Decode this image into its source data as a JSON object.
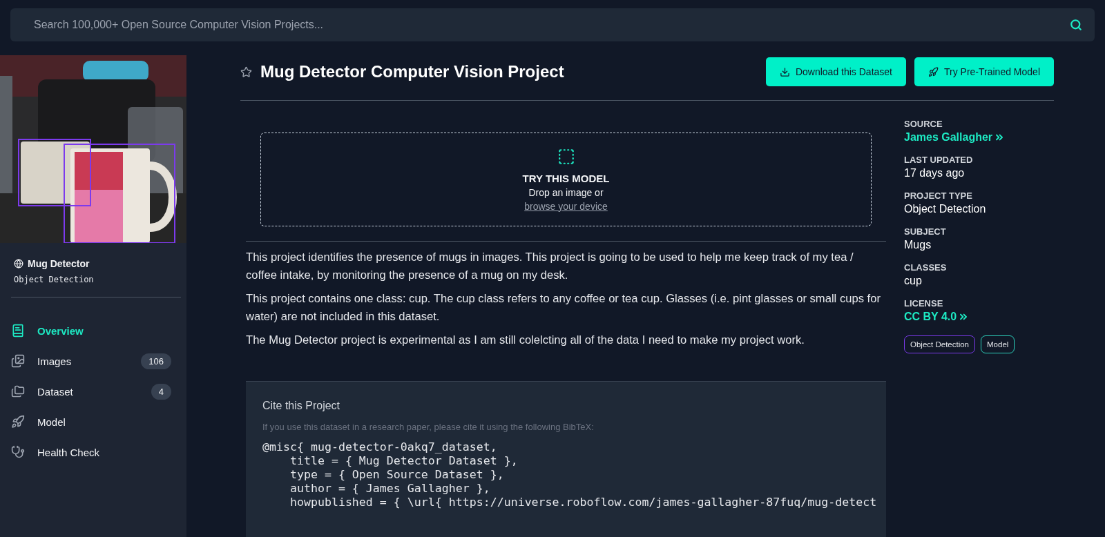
{
  "search": {
    "placeholder": "Search 100,000+ Open Source Computer Vision Projects..."
  },
  "project_card": {
    "name": "Mug Detector",
    "type": "Object Detection"
  },
  "nav": [
    {
      "label": "Overview",
      "selected": true
    },
    {
      "label": "Images",
      "count": "106",
      "selected": false
    },
    {
      "label": "Dataset",
      "count": "4",
      "selected": false
    },
    {
      "label": "Model",
      "selected": false
    },
    {
      "label": "Health Check",
      "selected": false
    }
  ],
  "header": {
    "title": "Mug Detector Computer Vision Project",
    "buttons": [
      "Download this Dataset",
      "Try Pre-Trained Model"
    ]
  },
  "try_model": {
    "title": "TRY THIS MODEL",
    "text": "Drop an image or",
    "link": "browse your device"
  },
  "description": [
    "This project identifies the presence of mugs in images. This project is going to be used to help me keep track of my tea / coffee intake, by monitoring the presence of a mug on my desk.",
    "This project contains one class: cup. The cup class refers to any coffee or tea cup. Glasses (i.e. pint glasses or small cups for water) are not included in this dataset.",
    "The Mug Detector project is experimental as I am still colelcting all of the data I need to make my project work."
  ],
  "cite": {
    "title": "Cite this Project",
    "hint": "If you use this dataset in a research paper, please cite it using the following BibTeX:",
    "code": [
      "@misc{ mug-detector-0akq7_dataset,",
      "    title = { Mug Detector Dataset },",
      "    type = { Open Source Dataset },",
      "    author = { James Gallagher },",
      "    howpublished = { \\url{ https://universe.roboflow.com/james-gallagher-87fuq/mug-detect"
    ]
  },
  "meta": [
    {
      "label": "SOURCE",
      "value": "James Gallagher",
      "link": true
    },
    {
      "label": "LAST UPDATED",
      "value": "17 days ago",
      "link": false
    },
    {
      "label": "PROJECT TYPE",
      "value": "Object Detection",
      "link": false
    },
    {
      "label": "SUBJECT",
      "value": "Mugs",
      "link": false
    },
    {
      "label": "CLASSES",
      "value": "cup",
      "link": false
    },
    {
      "label": "LICENSE",
      "value": "CC BY 4.0",
      "link": true
    }
  ],
  "tags": [
    {
      "label": "Object Detection",
      "color": "#7c3aed"
    },
    {
      "label": "Model",
      "color": "#2dd4bf"
    }
  ]
}
